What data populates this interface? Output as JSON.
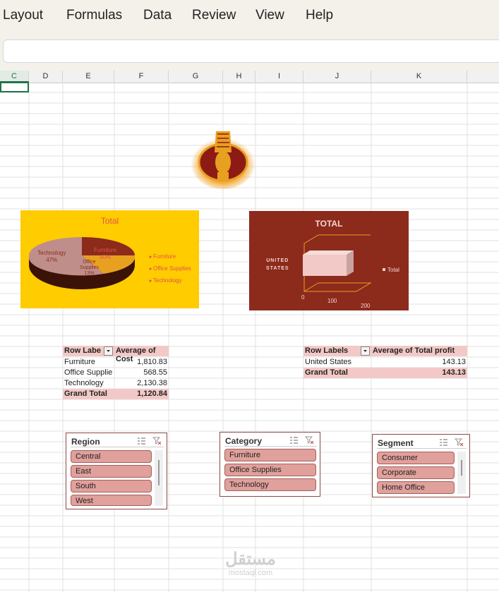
{
  "menu": [
    "Layout",
    "Formulas",
    "Data",
    "Review",
    "View",
    "Help"
  ],
  "columns": [
    "C",
    "D",
    "E",
    "F",
    "G",
    "H",
    "I",
    "J",
    "K"
  ],
  "pie_chart": {
    "title": "Total",
    "labels": [
      "Technology\n47%",
      "Furniture\n40%",
      "Office\nSupplies\n13%"
    ],
    "legend": [
      "Furniture",
      "Office Supplies",
      "Technology"
    ],
    "colors": {
      "bg": "#ffcc00",
      "title": "#e0534a"
    }
  },
  "bar_chart": {
    "title": "TOTAL",
    "category": "UNITED\nSTATES",
    "legend": "Total",
    "ticks": [
      "0",
      "100",
      "200"
    ],
    "colors": {
      "bg": "#8c2a1c",
      "bar": "#f2c9c6"
    }
  },
  "pivot_cost": {
    "headers": [
      "Row Labe",
      "Average of Cost"
    ],
    "rows": [
      {
        "label": "Furniture",
        "value": "1,810.83"
      },
      {
        "label": "Office Supplie",
        "value": "568.55"
      },
      {
        "label": "Technology",
        "value": "2,130.38"
      }
    ],
    "total": {
      "label": "Grand Total",
      "value": "1,120.84"
    }
  },
  "pivot_profit": {
    "headers": [
      "Row Labels",
      "Average of Total profit"
    ],
    "rows": [
      {
        "label": "United States",
        "value": "143.13"
      }
    ],
    "total": {
      "label": "Grand Total",
      "value": "143.13"
    }
  },
  "slicers": {
    "region": {
      "title": "Region",
      "items": [
        "Central",
        "East",
        "South",
        "West"
      ]
    },
    "category": {
      "title": "Category",
      "items": [
        "Furniture",
        "Office Supplies",
        "Technology"
      ]
    },
    "segment": {
      "title": "Segment",
      "items": [
        "Consumer",
        "Corporate",
        "Home Office"
      ]
    }
  },
  "watermark": {
    "arabic": "مستقل",
    "latin": "mostaql.com"
  }
}
